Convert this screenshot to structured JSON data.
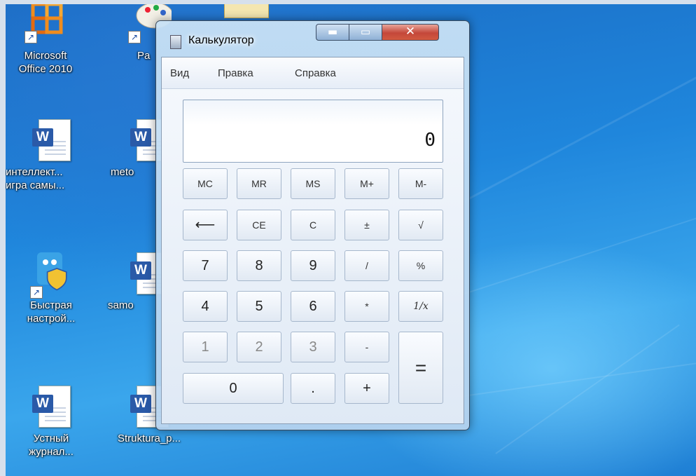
{
  "desktop": {
    "icons": [
      {
        "label_lines": [
          "Microsoft",
          "Office 2010"
        ],
        "icon": "office-icon"
      },
      {
        "label_lines": [
          "Pa"
        ],
        "icon": "paint-icon"
      },
      {
        "label_lines": [
          "интеллект...",
          "игра самы..."
        ],
        "icon": "word-doc-icon"
      },
      {
        "label_lines": [
          "meto"
        ],
        "icon": "word-doc-icon"
      },
      {
        "label_lines": [
          "Быстрая",
          "настрой..."
        ],
        "icon": "quick-setup-icon"
      },
      {
        "label_lines": [
          "samo"
        ],
        "icon": "word-doc-icon"
      },
      {
        "label_lines": [
          "Устный",
          "журнал..."
        ],
        "icon": "word-doc-icon"
      },
      {
        "label_lines": [
          "Struktura_p..."
        ],
        "icon": "word-doc-icon"
      }
    ]
  },
  "window": {
    "title": "Калькулятор",
    "controls": {
      "minimize": "▬",
      "maximize": "▭",
      "close": "✕"
    },
    "menu": [
      "Вид",
      "Правка",
      "Справка"
    ],
    "display": "0",
    "keys": {
      "mc": "MC",
      "mr": "MR",
      "ms": "MS",
      "mplus": "M+",
      "mminus": "M-",
      "backspace": "⟵",
      "ce": "CE",
      "c": "C",
      "plusminus": "±",
      "sqrt": "√",
      "d7": "7",
      "d8": "8",
      "d9": "9",
      "div": "/",
      "percent": "%",
      "d4": "4",
      "d5": "5",
      "d6": "6",
      "mul": "*",
      "recip": "1/x",
      "d1": "1",
      "d2": "2",
      "d3": "3",
      "minus": "-",
      "equals": "=",
      "d0": "0",
      "dot": ".",
      "plus": "+"
    }
  }
}
